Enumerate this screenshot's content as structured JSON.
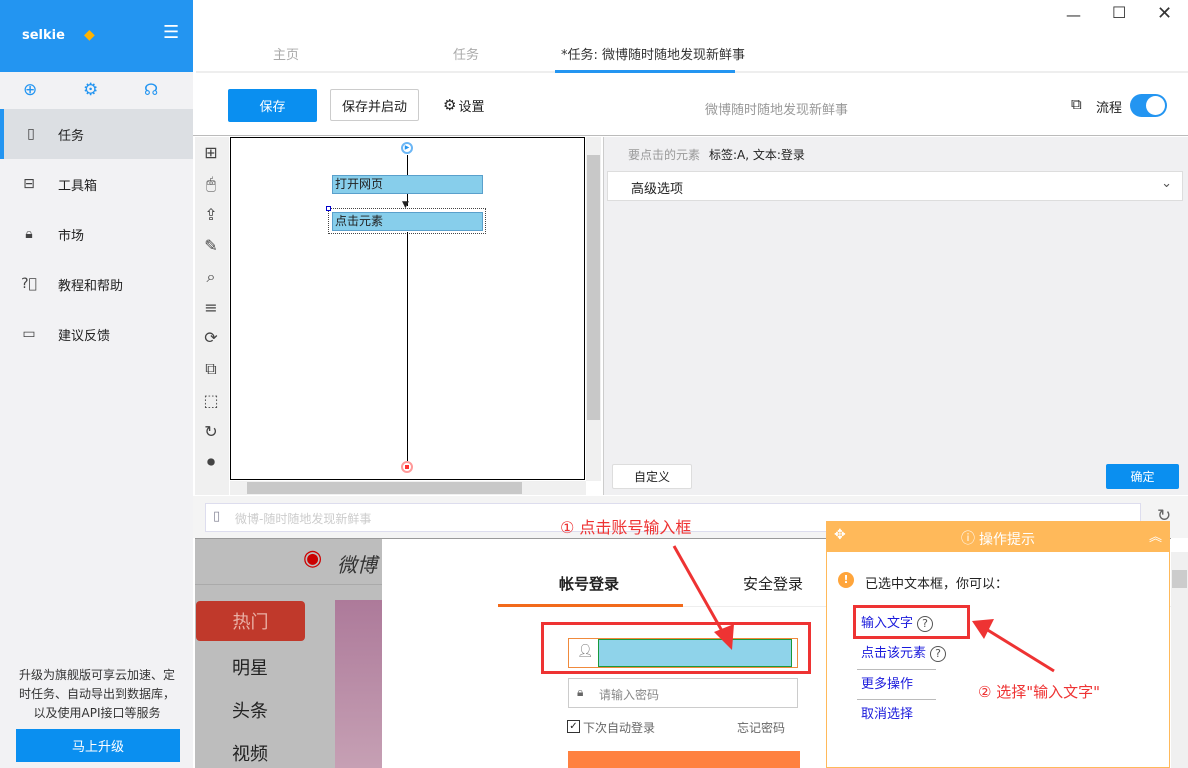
{
  "app": {
    "name": "selkie"
  },
  "sidebar": {
    "items": [
      {
        "label": "任务",
        "icon": "file-icon"
      },
      {
        "label": "工具箱",
        "icon": "toolbox-icon"
      },
      {
        "label": "市场",
        "icon": "lock-icon"
      },
      {
        "label": "教程和帮助",
        "icon": "help-icon"
      },
      {
        "label": "建议反馈",
        "icon": "feedback-icon"
      }
    ],
    "promo": "升级为旗舰版可享云加速、定时任务、自动导出到数据库，以及使用API接口等服务",
    "upgrade": "马上升级"
  },
  "tabs": [
    {
      "label": "主页"
    },
    {
      "label": "任务"
    },
    {
      "label": "*任务: 微博随时随地发现新鲜事"
    }
  ],
  "toolbar": {
    "save": "保存",
    "save_start": "保存并启动",
    "settings": "设置",
    "title": "微博随时随地发现新鲜事",
    "flow": "流程",
    "flow_on": true
  },
  "flow": {
    "nodes": [
      "打开网页",
      "点击元素"
    ]
  },
  "panel": {
    "element_label": "要点击的元素",
    "element_value": "标签:A, 文本:登录",
    "advanced": "高级选项",
    "custom": "自定义",
    "ok": "确定"
  },
  "browser": {
    "address": "微博-随时随地发现新鲜事"
  },
  "weibo": {
    "logo": "微博",
    "nav": [
      "热门",
      "明星",
      "头条",
      "视频"
    ],
    "tab_account": "帐号登录",
    "tab_secure": "安全登录",
    "password_placeholder": "请输入密码",
    "remember": "下次自动登录",
    "forgot": "忘记密码"
  },
  "annotations": {
    "step1": "① 点击账号输入框",
    "step2": "② 选择\"输入文字\""
  },
  "tips": {
    "title": "操作提示",
    "message": "已选中文本框，你可以：",
    "actions": [
      "输入文字",
      "点击该元素",
      "更多操作",
      "取消选择"
    ]
  },
  "colors": {
    "accent": "#2395f1",
    "tip": "#ffb95a",
    "annotation": "#ee3333"
  }
}
